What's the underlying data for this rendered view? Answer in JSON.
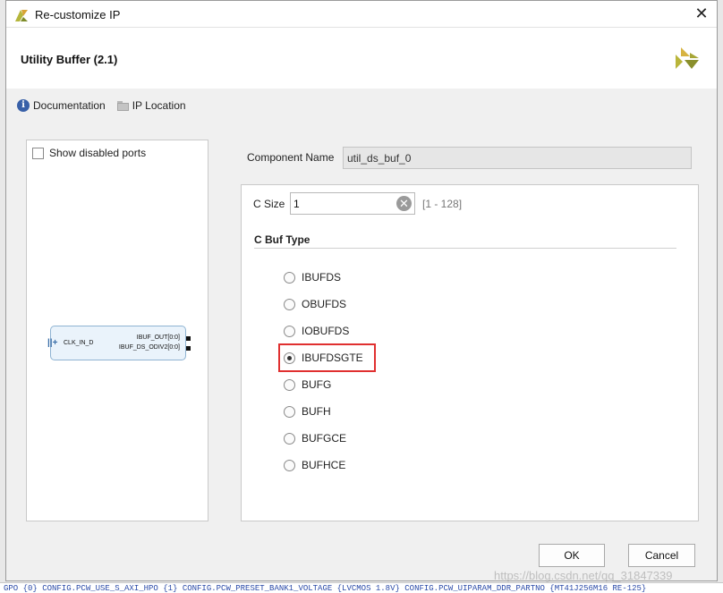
{
  "window": {
    "title": "Re-customize IP",
    "close_glyph": "✕"
  },
  "header": {
    "ip_name": "Utility Buffer (2.1)"
  },
  "links": {
    "documentation": "Documentation",
    "ip_location": "IP Location"
  },
  "symbol_panel": {
    "show_disabled_ports": "Show disabled ports",
    "show_disabled_checked": false,
    "input_port": "CLK_IN_D",
    "output_ports": [
      "IBUF_OUT[0:0]",
      "IBUF_DS_ODIV2[0:0]"
    ]
  },
  "component": {
    "label": "Component Name",
    "value": "util_ds_buf_0"
  },
  "config": {
    "c_size_label": "C Size",
    "c_size_value": "1",
    "c_size_range": "[1 - 128]",
    "c_buf_type_title": "C Buf Type",
    "buf_types": [
      "IBUFDS",
      "OBUFDS",
      "IOBUFDS",
      "IBUFDSGTE",
      "BUFG",
      "BUFH",
      "BUFGCE",
      "BUFHCE"
    ],
    "selected": "IBUFDSGTE"
  },
  "buttons": {
    "ok": "OK",
    "cancel": "Cancel"
  },
  "background": {
    "tcl_line": "GPO {0} CONFIG.PCW_USE_S_AXI_HPO {1} CONFIG.PCW_PRESET_BANK1_VOLTAGE {LVCMOS 1.8V} CONFIG.PCW_UIPARAM_DDR_PARTNO {MT41J256M16 RE-125}",
    "watermark": "https://blog.csdn.net/qq_31847339"
  },
  "colors": {
    "highlight": "#e03030",
    "symbol_fill": "#eaf3fb",
    "symbol_border": "#8eb3d2",
    "doc_icon": "#3860a8"
  }
}
